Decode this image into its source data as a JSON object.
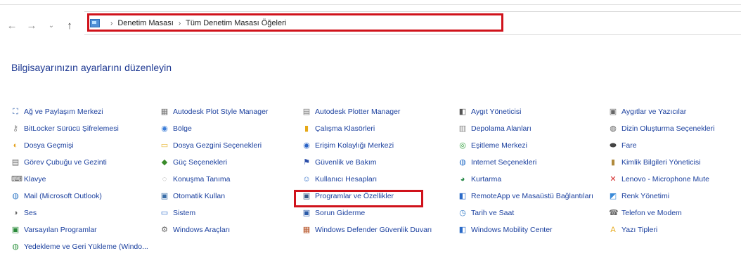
{
  "navigation": {
    "back_icon": "←",
    "forward_icon": "→",
    "recent_icon": "⌄",
    "up_icon": "↑"
  },
  "breadcrumb": {
    "items": [
      "Denetim Masası",
      "Tüm Denetim Masası Öğeleri"
    ],
    "separator": "›"
  },
  "heading": "Bilgisayarınızın ayarlarını düzenleyin",
  "items": [
    [
      "Ağ ve Paylaşım Merkezi",
      "Autodesk Plot Style Manager",
      "Autodesk Plotter Manager",
      "Aygıt Yöneticisi",
      "Aygıtlar ve Yazıcılar"
    ],
    [
      "BitLocker Sürücü Şifrelemesi",
      "Bölge",
      "Çalışma Klasörleri",
      "Depolama Alanları",
      "Dizin Oluşturma Seçenekleri"
    ],
    [
      "Dosya Geçmişi",
      "Dosya Gezgini Seçenekleri",
      "Erişim Kolaylığı Merkezi",
      "Eşitleme Merkezi",
      "Fare"
    ],
    [
      "Görev Çubuğu ve Gezinti",
      "Güç Seçenekleri",
      "Güvenlik ve Bakım",
      "Internet Seçenekleri",
      "Kimlik Bilgileri Yöneticisi"
    ],
    [
      "Klavye",
      "Konuşma Tanıma",
      "Kullanıcı Hesapları",
      "Kurtarma",
      "Lenovo - Microphone Mute"
    ],
    [
      "Mail (Microsoft Outlook)",
      "Otomatik Kullan",
      "Programlar ve Özellikler",
      "RemoteApp ve Masaüstü Bağlantıları",
      "Renk Yönetimi"
    ],
    [
      "Ses",
      "Sistem",
      "Sorun Giderme",
      "Tarih ve Saat",
      "Telefon ve Modem"
    ],
    [
      "Varsayılan Programlar",
      "Windows Araçları",
      "Windows Defender Güvenlik Duvarı",
      "Windows Mobility Center",
      "Yazı Tipleri"
    ],
    [
      "Yedekleme ve Geri Yükleme (Windo..."
    ]
  ],
  "icons": [
    [
      "network-icon",
      "plot-style-icon",
      "plotter-icon",
      "device-manager-icon",
      "printer-icon"
    ],
    [
      "bitlocker-icon",
      "region-icon",
      "work-folders-icon",
      "storage-icon",
      "indexing-icon"
    ],
    [
      "file-history-icon",
      "folder-options-icon",
      "accessibility-icon",
      "sync-icon",
      "mouse-icon"
    ],
    [
      "taskbar-icon",
      "power-icon",
      "security-flag-icon",
      "internet-icon",
      "credential-icon"
    ],
    [
      "keyboard-icon",
      "speech-icon",
      "user-accounts-icon",
      "recovery-icon",
      "microphone-mute-icon"
    ],
    [
      "mail-icon",
      "autoplay-icon",
      "programs-icon",
      "remoteapp-icon",
      "color-icon"
    ],
    [
      "sound-icon",
      "system-icon",
      "troubleshoot-icon",
      "date-time-icon",
      "phone-modem-icon"
    ],
    [
      "default-programs-icon",
      "windows-tools-icon",
      "firewall-icon",
      "mobility-icon",
      "fonts-icon"
    ],
    [
      "backup-icon"
    ]
  ],
  "colors": {
    "highlight": "#d0121b",
    "link": "#1a3f9e",
    "heading": "#1f3a93"
  }
}
